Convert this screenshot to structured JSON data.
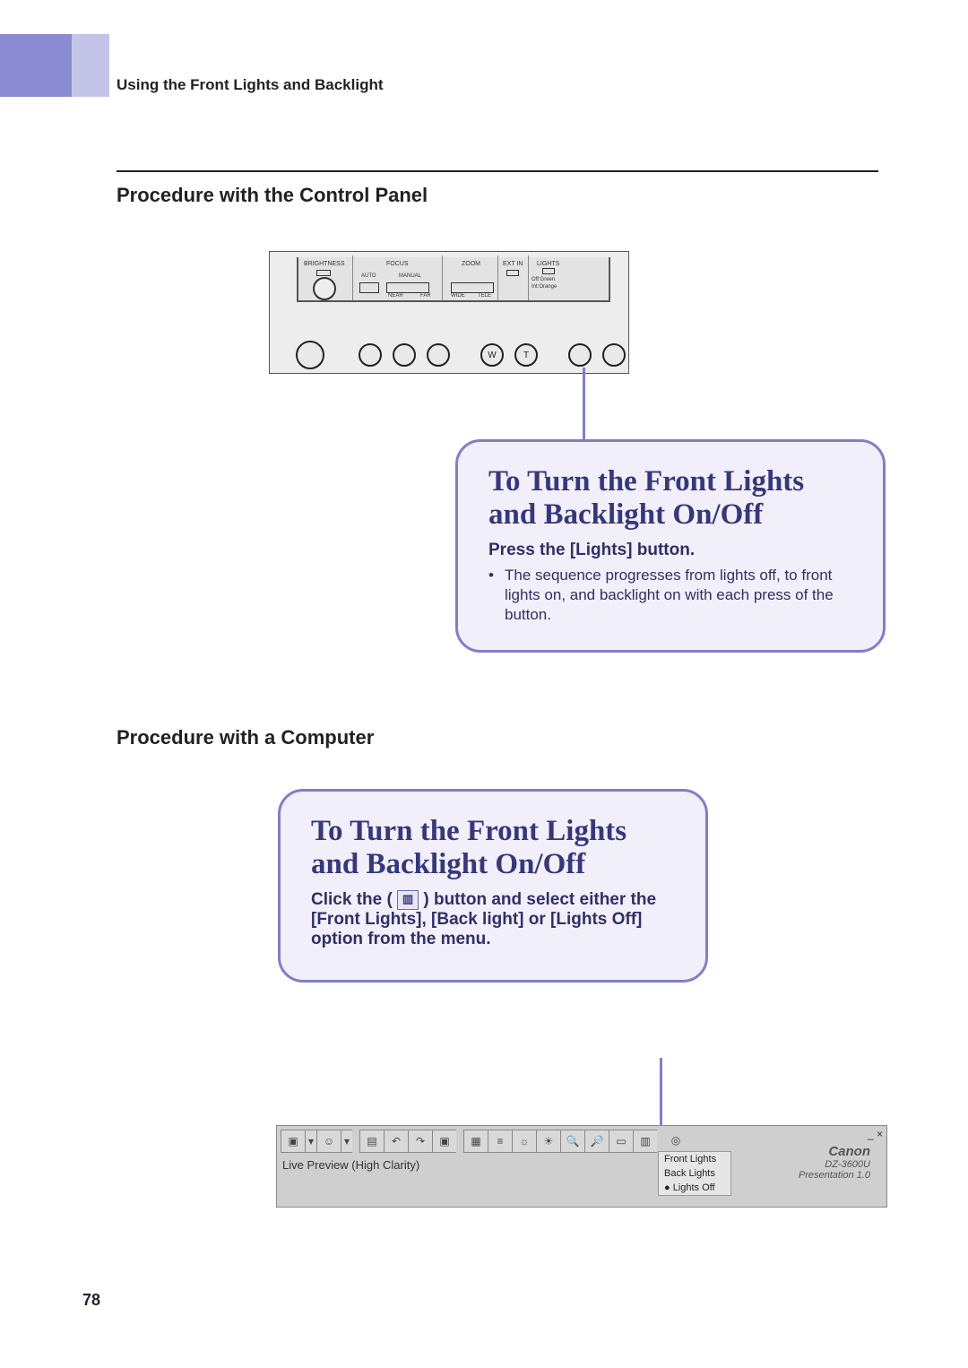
{
  "running_head": "Using the Front Lights and Backlight",
  "proc_heading_1": "Procedure with the Control Panel",
  "proc_heading_2": "Procedure with a Computer",
  "panel": {
    "labels": {
      "brightness": "BRIGHTNESS",
      "focus": "FOCUS",
      "auto": "AUTO",
      "manual": "MANUAL",
      "near": "NEAR",
      "far": "FAR",
      "zoom": "ZOOM",
      "wide": "WIDE",
      "tele": "TELE",
      "ext_in": "EXT IN",
      "lights": "LIGHTS",
      "lights_note1": "Off:Green",
      "lights_note2": "Int:Orange"
    },
    "row_letters": {
      "w": "W",
      "t": "T"
    }
  },
  "callout1": {
    "title": "To Turn the Front Lights and Backlight On/Off",
    "sub": "Press the [Lights] button.",
    "bullet": "The sequence progresses from lights off, to front lights on, and backlight on with each press of the button."
  },
  "callout2": {
    "title": "To Turn the Front Lights and Backlight On/Off",
    "sub_pre": "Click the ( ",
    "sub_post": " ) button and select either the [Front Lights], [Back light] or [Lights Off] option from the menu.",
    "icon_glyph": "▥"
  },
  "software": {
    "status": "Live Preview (High Clarity)",
    "menu": {
      "front": "Front Lights",
      "back": "Back Lights",
      "off": "Lights Off"
    },
    "brand": "Canon",
    "model": "DZ-3600U",
    "app": "Presentation 1.0",
    "close": "×",
    "min": "_"
  },
  "page_number": "78"
}
